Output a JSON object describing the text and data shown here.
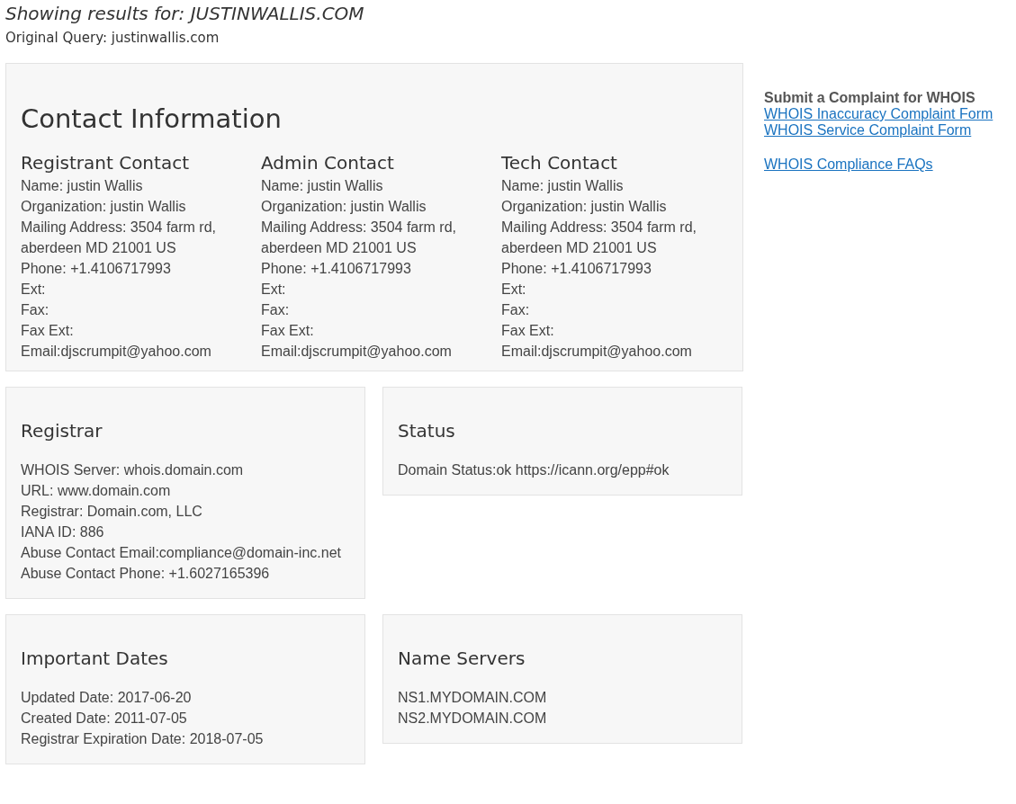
{
  "header": {
    "title": "Showing results for: JUSTINWALLIS.COM",
    "original_query": "Original Query: justinwallis.com"
  },
  "contact": {
    "title": "Contact Information",
    "contacts": [
      {
        "heading": "Registrant Contact",
        "lines": [
          "Name: justin Wallis",
          "Organization: justin Wallis",
          "Mailing Address: 3504 farm rd, aberdeen MD 21001 US",
          "Phone: +1.4106717993",
          "Ext:",
          "Fax:",
          "Fax Ext:",
          "Email:djscrumpit@yahoo.com"
        ]
      },
      {
        "heading": "Admin Contact",
        "lines": [
          "Name: justin Wallis",
          "Organization: justin Wallis",
          "Mailing Address: 3504 farm rd, aberdeen MD 21001 US",
          "Phone: +1.4106717993",
          "Ext:",
          "Fax:",
          "Fax Ext:",
          "Email:djscrumpit@yahoo.com"
        ]
      },
      {
        "heading": "Tech Contact",
        "lines": [
          "Name: justin Wallis",
          "Organization: justin Wallis",
          "Mailing Address: 3504 farm rd, aberdeen MD 21001 US",
          "Phone: +1.4106717993",
          "Ext:",
          "Fax:",
          "Fax Ext:",
          "Email:djscrumpit@yahoo.com"
        ]
      }
    ]
  },
  "card_rows": [
    [
      {
        "title": "Registrar",
        "lines": [
          "WHOIS Server: whois.domain.com",
          "URL: www.domain.com",
          "Registrar: Domain.com, LLC",
          "IANA ID: 886",
          "Abuse Contact Email:compliance@domain-inc.net",
          "Abuse Contact Phone: +1.6027165396"
        ]
      },
      {
        "title": "Status",
        "lines": [
          "Domain Status:ok https://icann.org/epp#ok"
        ]
      }
    ],
    [
      {
        "title": "Important Dates",
        "lines": [
          "Updated Date: 2017-06-20",
          "Created Date: 2011-07-05",
          "Registrar Expiration Date: 2018-07-05"
        ]
      },
      {
        "title": "Name Servers",
        "lines": [
          "NS1.MYDOMAIN.COM",
          "NS2.MYDOMAIN.COM"
        ]
      }
    ]
  ],
  "sidebar": {
    "heading": "Submit a Complaint for WHOIS",
    "link_groups": [
      [
        "WHOIS Inaccuracy Complaint Form",
        "WHOIS Service Complaint Form"
      ],
      [
        "WHOIS Compliance FAQs"
      ]
    ]
  }
}
